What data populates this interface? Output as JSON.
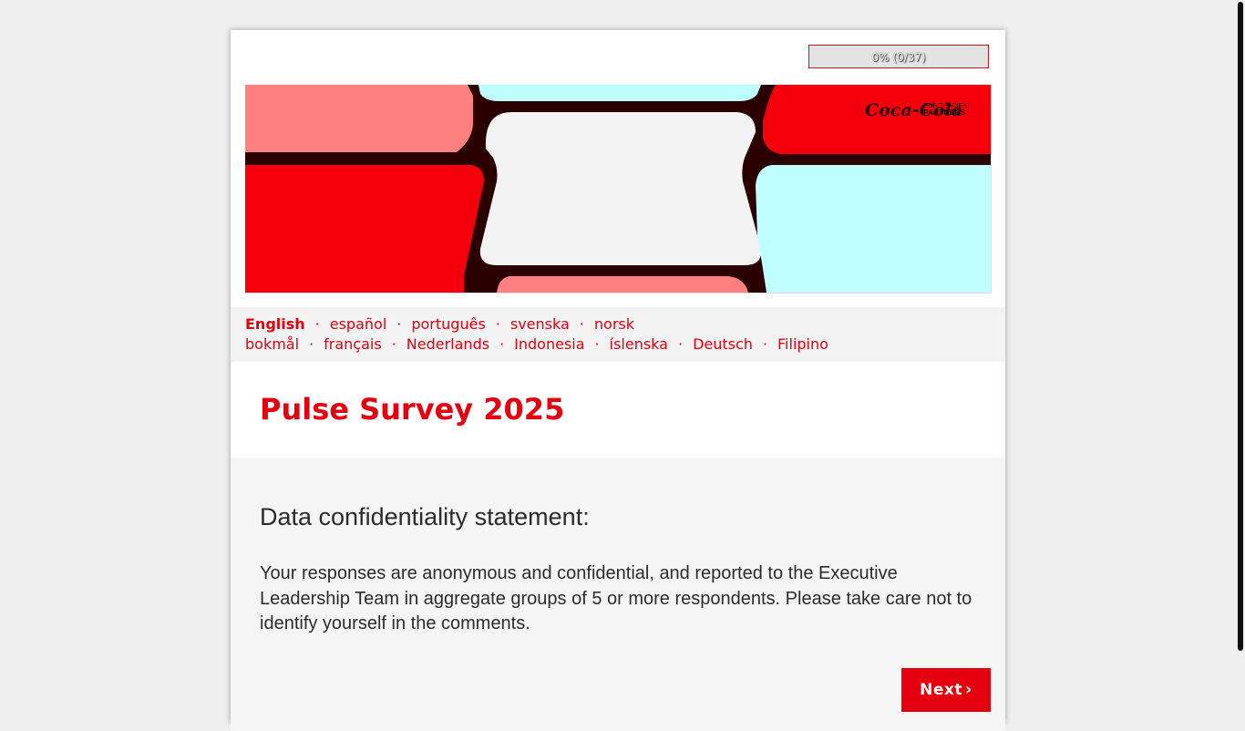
{
  "progress": {
    "label": "0% (0/37)",
    "fraction": 0
  },
  "banner": {
    "logo_script": "Coca-Cola",
    "logo_line1": "EUROPACIFIC",
    "logo_line2": "PARTNERS"
  },
  "languages": {
    "items": [
      "English",
      "español",
      "português",
      "svenska",
      "norsk bokmål",
      "français",
      "Nederlands",
      "Indonesia",
      "íslenska",
      "Deutsch",
      "Filipino"
    ],
    "current": "English",
    "separator": "·"
  },
  "survey": {
    "title": "Pulse Survey 2025"
  },
  "content": {
    "heading": "Data confidentiality statement:",
    "body": "Your responses are anonymous and confidential, and reported to the Executive Leadership Team in aggregate groups of 5 or more respondents. Please take care not to identify yourself in the comments."
  },
  "nav": {
    "next_label": "Next",
    "next_chevron": "›"
  },
  "colors": {
    "brand_red": "#e3000f",
    "banner_red": "#f4000c",
    "banner_pink": "#ff8080",
    "banner_cyan": "#c0ffff",
    "banner_dark": "#2a0000",
    "banner_light": "#f3f3f3"
  }
}
